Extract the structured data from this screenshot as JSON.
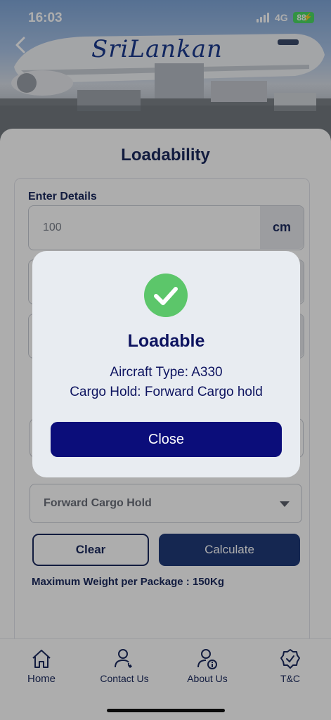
{
  "status_bar": {
    "time": "16:03",
    "network": "4G",
    "battery": "88"
  },
  "hero": {
    "brand_text": "SriLankan"
  },
  "page": {
    "title": "Loadability"
  },
  "form": {
    "section_label": "Enter Details",
    "length_value": "100",
    "unit": "cm",
    "cargo_hold_selected": "Forward Cargo Hold"
  },
  "buttons": {
    "clear": "Clear",
    "calculate": "Calculate"
  },
  "max_weight_text": "Maximum Weight per Package : 150Kg",
  "nav": {
    "items": [
      {
        "label": "Home",
        "icon": "home-icon"
      },
      {
        "label": "Contact Us",
        "icon": "contact-icon"
      },
      {
        "label": "About Us",
        "icon": "about-icon"
      },
      {
        "label": "T&C",
        "icon": "badge-check-icon"
      }
    ]
  },
  "dialog": {
    "title": "Loadable",
    "line1": "Aircraft Type: A330",
    "line2": "Cargo Hold: Forward Cargo hold",
    "close_label": "Close",
    "icon": "success-check-icon"
  },
  "colors": {
    "primary": "#0b0d7a",
    "navy": "#1b2a5e",
    "success": "#5cc66a",
    "calculate": "#1f3a78"
  }
}
